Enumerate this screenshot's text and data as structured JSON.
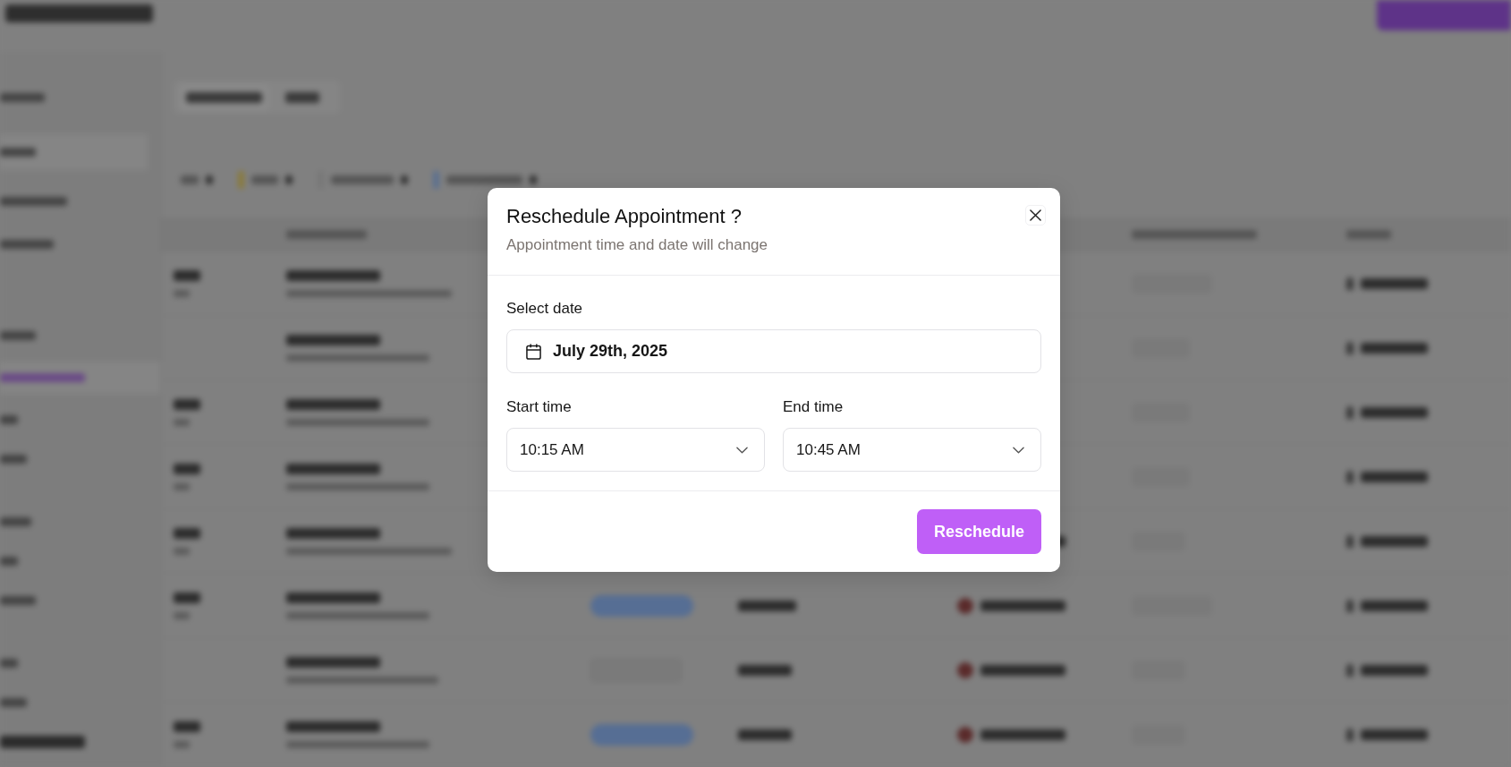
{
  "dialog": {
    "title": "Reschedule Appointment ?",
    "subtitle": "Appointment time and date will change",
    "date_field": {
      "label": "Select date",
      "value": "July 29th, 2025"
    },
    "time_fields": [
      {
        "label": "Start time",
        "value": "10:15 AM"
      },
      {
        "label": "End time",
        "value": "10:45 AM"
      }
    ],
    "primary_button": "Reschedule"
  }
}
